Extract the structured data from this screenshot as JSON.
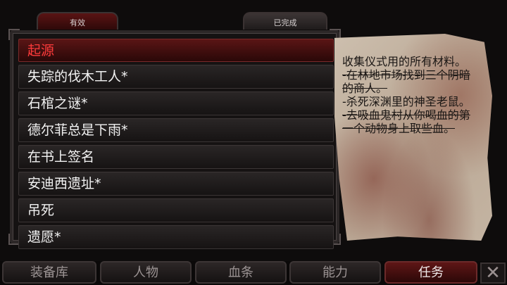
{
  "tabs": {
    "active_label": "有效",
    "completed_label": "已完成"
  },
  "quests": [
    {
      "title": "起源"
    },
    {
      "title": "失踪的伐木工人*"
    },
    {
      "title": "石棺之谜*"
    },
    {
      "title": "德尔菲总是下雨*"
    },
    {
      "title": "在书上签名"
    },
    {
      "title": "安迪西遗址*"
    },
    {
      "title": "吊死"
    },
    {
      "title": "遗愿*"
    }
  ],
  "selected_quest": "起源",
  "description": {
    "intro": "收集仪式用的所有材料。",
    "tasks": [
      {
        "text": "-在林地市场找到三个阴暗的商人。",
        "done": true
      },
      {
        "text": "-杀死深渊里的神圣老鼠。",
        "done": false
      },
      {
        "text": "-去吸血鬼村从你喝血的第一个动物身上取些血。",
        "done": true
      }
    ]
  },
  "bottom_nav": [
    {
      "label": "装备库"
    },
    {
      "label": "人物"
    },
    {
      "label": "血条"
    },
    {
      "label": "能力"
    },
    {
      "label": "任务"
    }
  ],
  "active_nav": "任务",
  "close_label": "✕",
  "colors": {
    "selected_text": "#ff3b3b",
    "accent_red": "#5a1515",
    "parchment": "#c4b4a2"
  }
}
